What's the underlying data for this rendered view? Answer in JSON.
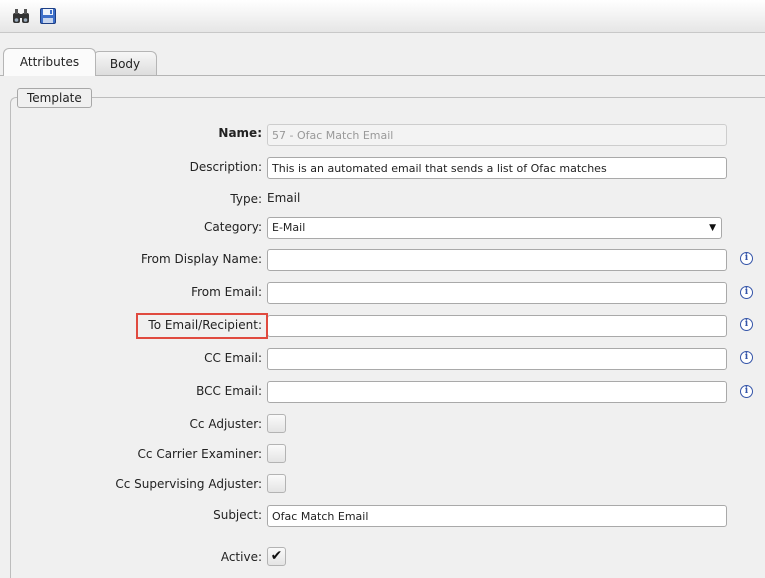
{
  "toolbar": {
    "icons": [
      "binoculars-icon",
      "save-icon"
    ]
  },
  "tabs": [
    {
      "label": "Attributes",
      "active": true
    },
    {
      "label": "Body",
      "active": false
    }
  ],
  "section": {
    "legend": "Template"
  },
  "form": {
    "name": {
      "label": "Name:",
      "value": "57 - Ofac Match Email"
    },
    "description": {
      "label": "Description:",
      "value": "This is an automated email that sends a list of Ofac matches"
    },
    "type": {
      "label": "Type:",
      "value": "Email"
    },
    "category": {
      "label": "Category:",
      "value": "E-Mail"
    },
    "from_display_name": {
      "label": "From Display Name:",
      "value": ""
    },
    "from_email": {
      "label": "From Email:",
      "value": ""
    },
    "to_email": {
      "label": "To Email/Recipient:",
      "value": ""
    },
    "cc_email": {
      "label": "CC Email:",
      "value": ""
    },
    "bcc_email": {
      "label": "BCC Email:",
      "value": ""
    },
    "cc_adjuster": {
      "label": "Cc Adjuster:",
      "checked": false
    },
    "cc_carrier_examiner": {
      "label": "Cc Carrier Examiner:",
      "checked": false
    },
    "cc_supervising_adjuster": {
      "label": "Cc Supervising Adjuster:",
      "checked": false
    },
    "subject": {
      "label": "Subject:",
      "value": "Ofac Match Email"
    },
    "active": {
      "label": "Active:",
      "checked": true
    }
  },
  "info_icon_glyph": "i",
  "checkmark_glyph": "✔",
  "dropdown_arrow_glyph": "▼",
  "colors": {
    "highlight_border": "#e04a3f",
    "info_icon": "#3454a8"
  }
}
